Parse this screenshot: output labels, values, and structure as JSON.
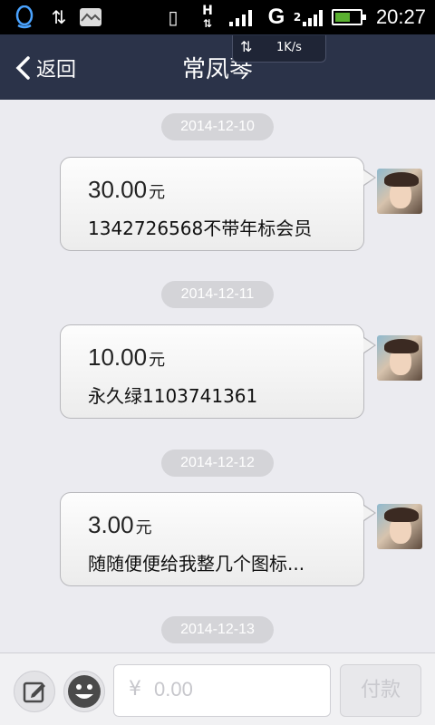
{
  "status_bar": {
    "time": "20:27",
    "network_h": "H",
    "network_g": "G",
    "sim2_label": "2"
  },
  "header": {
    "back_label": "返回",
    "title": "常凤琴",
    "speed": "1K/s"
  },
  "messages": [
    {
      "date": "2014-12-10",
      "amount": "30.00",
      "unit": "元",
      "note": "1342726568不带年标会员"
    },
    {
      "date": "2014-12-11",
      "amount": "10.00",
      "unit": "元",
      "note": "永久绿1103741361"
    },
    {
      "date": "2014-12-12",
      "amount": "3.00",
      "unit": "元",
      "note": "随随便便给我整几个图标..."
    },
    {
      "date": "2014-12-13"
    }
  ],
  "bottom": {
    "currency_symbol": "¥",
    "amount_placeholder": "0.00",
    "pay_label": "付款"
  },
  "colors": {
    "titlebar": "#2b3349",
    "background": "#ebebf0",
    "date_pill": "#d4d4d8"
  }
}
